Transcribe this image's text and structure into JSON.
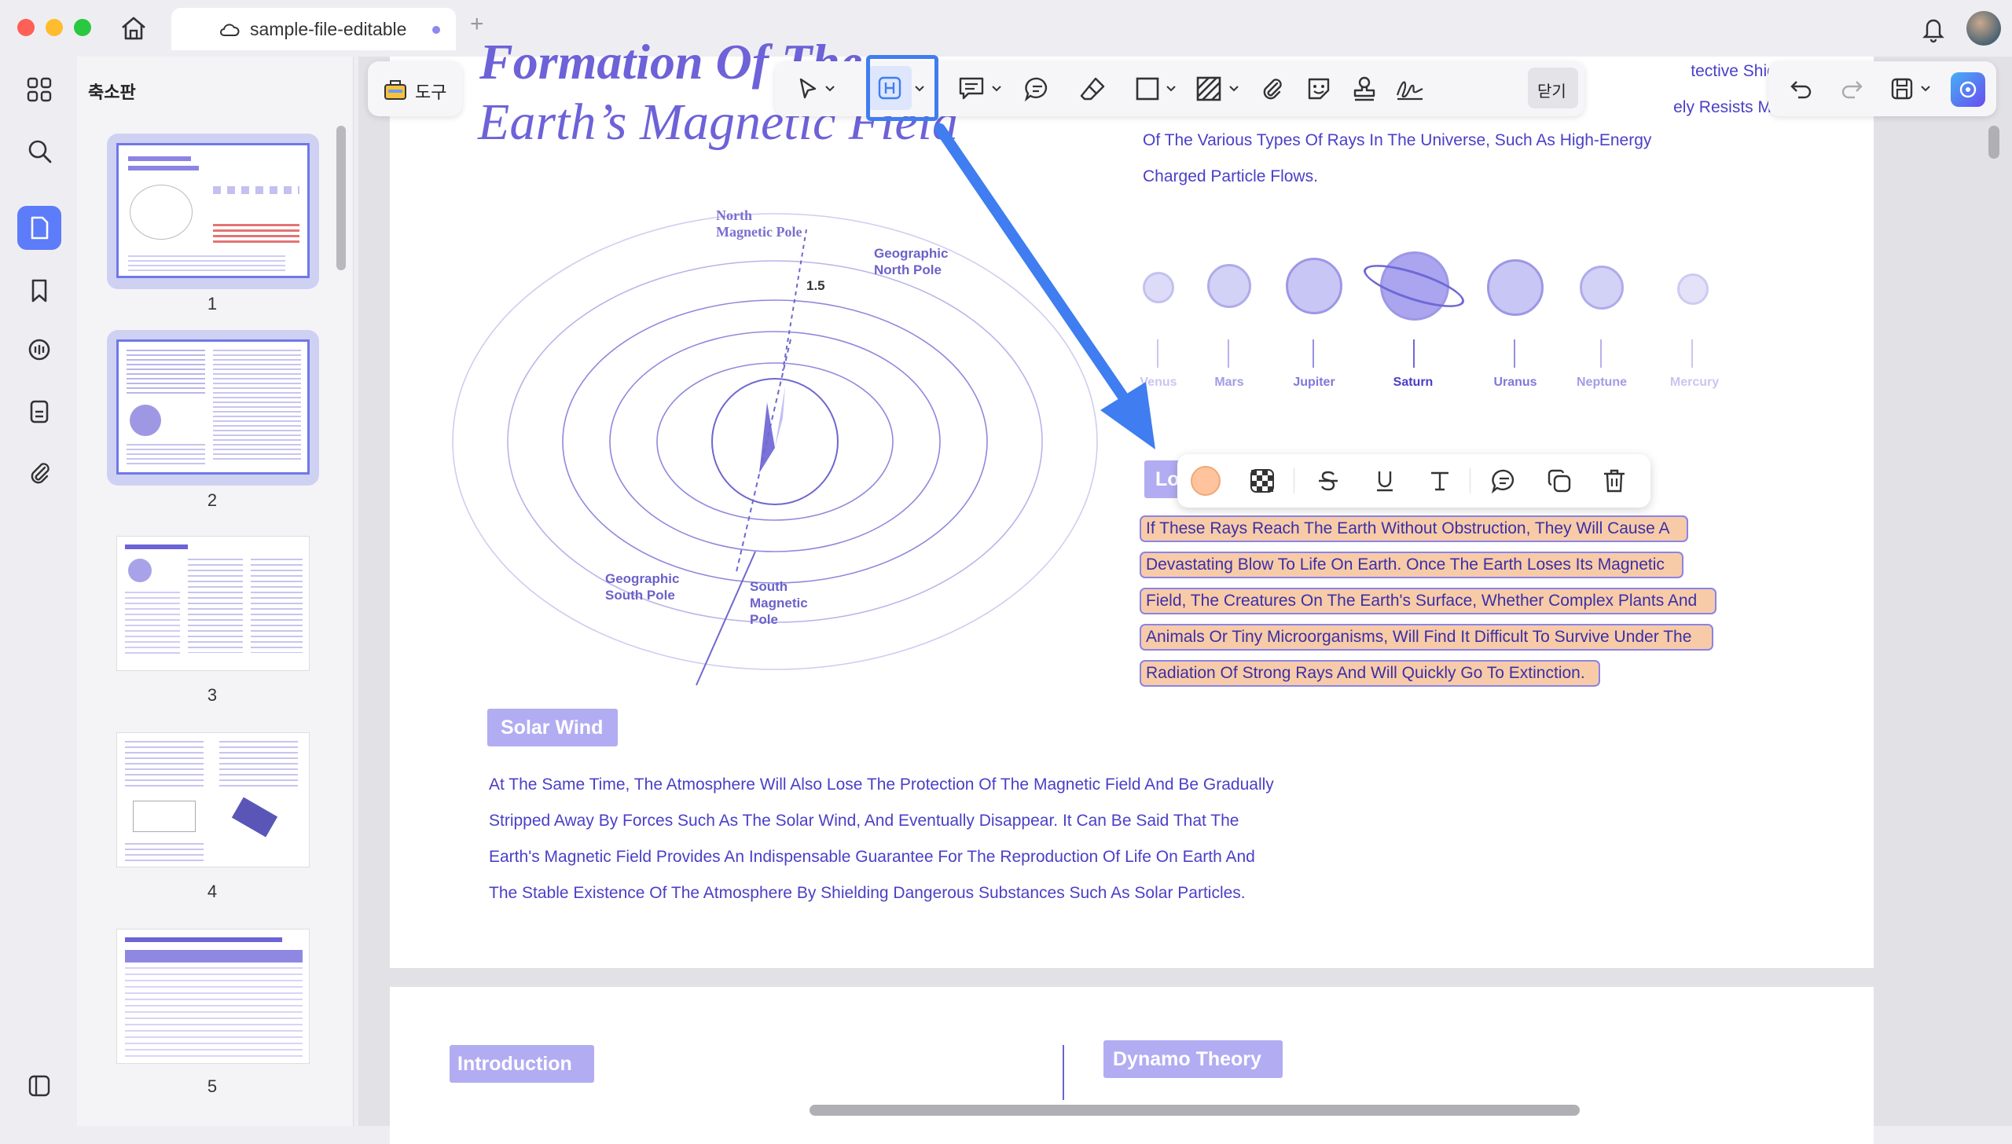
{
  "window": {
    "tab_title": "sample-file-editable",
    "new_tab_symbol": "+"
  },
  "sidebar": {
    "panel_title": "축소판",
    "thumbnails": [
      {
        "page": "1",
        "selected": true
      },
      {
        "page": "2",
        "selected": true
      },
      {
        "page": "3",
        "selected": false
      },
      {
        "page": "4",
        "selected": false
      },
      {
        "page": "5",
        "selected": false
      }
    ]
  },
  "toolbar": {
    "tools_label": "도구",
    "close_label": "닫기"
  },
  "document": {
    "title_line1": "Formation Of The",
    "title_line2": "Earth’s Magnetic Field",
    "diagram_labels": {
      "north_magnetic_pole": [
        "North",
        "Magnetic Pole"
      ],
      "geographic_north_pole": [
        "Geographic",
        "North Pole"
      ],
      "angle": "1.5",
      "geographic_south_pole": [
        "Geographic",
        "South Pole"
      ],
      "south_magnetic_pole": [
        "South",
        "Magnetic",
        "Pole"
      ]
    },
    "intro_text_lines": [
      "tective Shield,",
      "ely Resists Most",
      "Of The Various Types Of Rays In The Universe, Such As High-Energy",
      "Charged Particle Flows."
    ],
    "planets": [
      {
        "name": "Venus"
      },
      {
        "name": "Mars"
      },
      {
        "name": "Jupiter"
      },
      {
        "name": "Saturn"
      },
      {
        "name": "Uranus"
      },
      {
        "name": "Neptune"
      },
      {
        "name": "Mercury"
      }
    ],
    "partial_tag": "Lo",
    "highlighted_lines": [
      "If These Rays Reach The Earth Without Obstruction, They Will Cause A",
      "Devastating Blow To Life On Earth. Once The Earth Loses Its Magnetic",
      "Field, The Creatures On The Earth's Surface, Whether Complex Plants And",
      "Animals Or Tiny Microorganisms, Will Find It Difficult To Survive Under The",
      "Radiation Of Strong Rays And Will Quickly Go To Extinction."
    ],
    "solar_wind_tag": "Solar Wind",
    "solar_wind_lines": [
      "At The Same Time, The Atmosphere Will Also Lose The Protection Of The Magnetic Field And Be Gradually",
      "Stripped Away By Forces Such As The Solar Wind, And Eventually Disappear. It Can Be Said That The",
      "Earth's Magnetic Field Provides An Indispensable Guarantee For The Reproduction Of Life On Earth And",
      "The Stable Existence Of The Atmosphere By Shielding Dangerous Substances Such As Solar Particles."
    ],
    "page2_tags": {
      "introduction": "Introduction",
      "dynamo_theory": "Dynamo Theory"
    }
  },
  "colors": {
    "accent_blue": "#3f7df0",
    "highlight_fill": "#f8cba8",
    "purple_text": "#4a3fc7",
    "tag_purple": "#b2acf2"
  }
}
